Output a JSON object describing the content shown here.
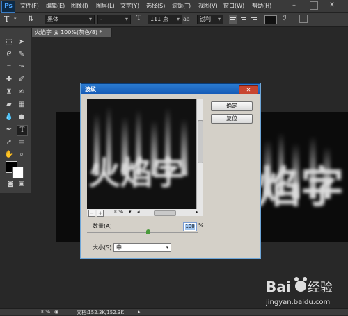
{
  "app": {
    "logo": "Ps"
  },
  "menu": [
    "文件(F)",
    "编辑(E)",
    "图像(I)",
    "图层(L)",
    "文字(Y)",
    "选择(S)",
    "滤镜(T)",
    "视图(V)",
    "窗口(W)",
    "帮助(H)"
  ],
  "options": {
    "tool_icon": "T",
    "font_family": "黑体",
    "font_style": "-",
    "font_size": "111 点",
    "aa_label": "aa",
    "antialias": "锐利"
  },
  "document": {
    "tab_title": "火焰字 @ 100%(灰色/8) *",
    "canvas_text": "焰字"
  },
  "dialog": {
    "title": "波纹",
    "close_icon": "close-icon",
    "ok_label": "确定",
    "reset_label": "复位",
    "zoom_minus": "−",
    "zoom_plus": "+",
    "zoom_value": "100%",
    "preview_text": "火焰字",
    "amount_label": "数量(A)",
    "amount_value": "100",
    "amount_unit": "%",
    "amount_fraction": 0.55,
    "size_label": "大小(S)",
    "size_value": "中"
  },
  "status": {
    "zoom": "100%",
    "doc_info": "文档:152.3K/152.3K"
  },
  "watermark": {
    "brand": "Baidu经验",
    "url": "jingyan.baidu.com"
  },
  "colors": {
    "accent": "#1459b5",
    "foreground": "#000000",
    "background": "#ffffff"
  }
}
